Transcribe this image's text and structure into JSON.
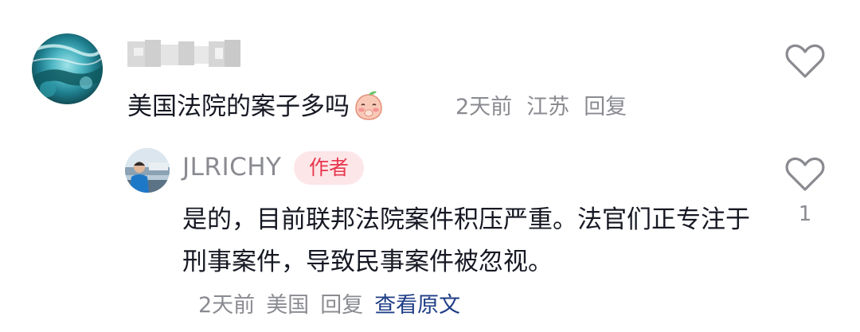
{
  "comment": {
    "text": "美国法院的案子多吗",
    "time": "2天前",
    "location": "江苏",
    "reply_label": "回复",
    "emoji_icon": "shy-peach-emoji-icon"
  },
  "reply": {
    "username": "JLRICHY",
    "author_badge": "作者",
    "text": "是的，目前联邦法院案件积压严重。法官们正专注于刑事案件，导致民事案件被忽视。",
    "time": "2天前",
    "location": "美国",
    "reply_label": "回复",
    "view_original_label": "查看原文",
    "like_count": "1"
  },
  "colors": {
    "primary_text": "#161823",
    "secondary_text": "#8a8b91",
    "badge_bg": "#fde6e8",
    "badge_text": "#e8374f",
    "link": "#1f3d86"
  }
}
